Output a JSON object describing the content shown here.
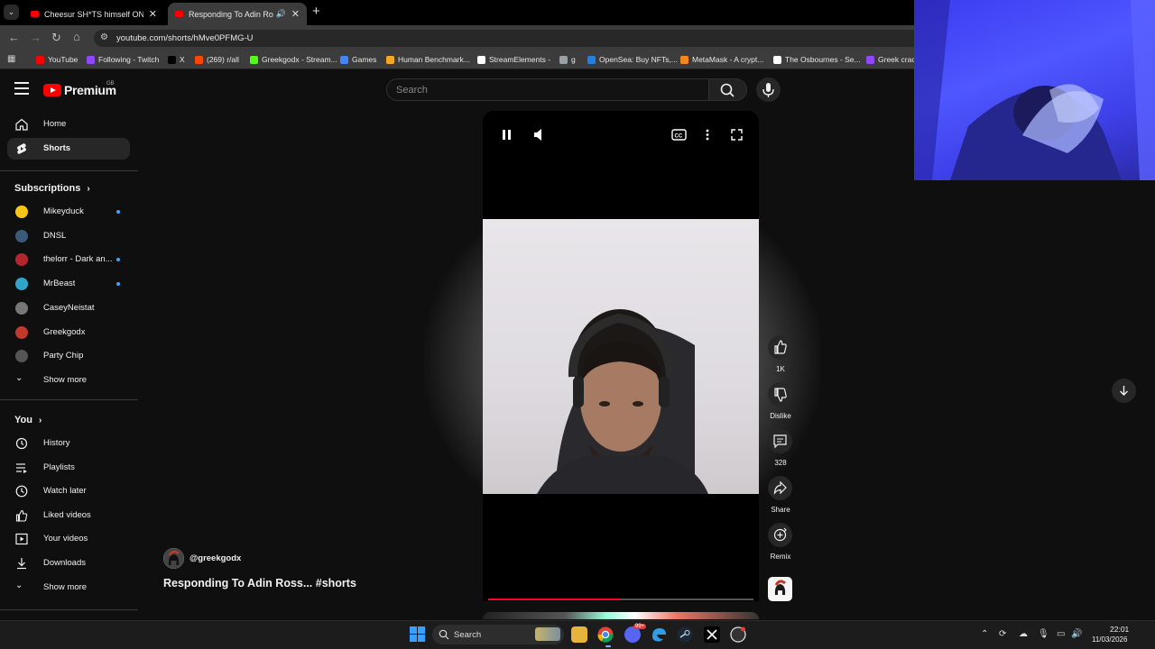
{
  "browser": {
    "tabs": [
      {
        "title": "Cheesur SH*TS himself ON STR",
        "active": false
      },
      {
        "title": "Responding To Adin Ross...",
        "active": true
      }
    ],
    "url": "youtube.com/shorts/hMve0PFMG-U",
    "bookmarks": [
      {
        "label": "YouTube",
        "color": "#ff0000"
      },
      {
        "label": "Following - Twitch",
        "color": "#9146ff"
      },
      {
        "label": "X",
        "color": "#000000"
      },
      {
        "label": "(269) r/all",
        "color": "#ff4500"
      },
      {
        "label": "Greekgodx - Stream...",
        "color": "#53fc18"
      },
      {
        "label": "Games",
        "color": "#4285f4"
      },
      {
        "label": "Human Benchmark...",
        "color": "#f5a623"
      },
      {
        "label": "StreamElements -",
        "color": "#ffffff"
      },
      {
        "label": "g",
        "color": "#9aa0a6"
      },
      {
        "label": "OpenSea: Buy NFTs,...",
        "color": "#2081e2"
      },
      {
        "label": "MetaMask - A crypt...",
        "color": "#f6851b"
      },
      {
        "label": "The Osbournes - Se...",
        "color": "#ffffff"
      },
      {
        "label": "Greek crack",
        "color": "#9146ff"
      }
    ]
  },
  "header": {
    "logo_text": "Premium",
    "country_code": "GB",
    "search_placeholder": "Search"
  },
  "sidebar": {
    "main": [
      {
        "label": "Home",
        "icon": "home-icon",
        "active": false
      },
      {
        "label": "Shorts",
        "icon": "shorts-icon",
        "active": true
      }
    ],
    "subscriptions_title": "Subscriptions",
    "subscriptions": [
      {
        "label": "Mikeyduck",
        "color": "#f5c518",
        "new": true
      },
      {
        "label": "DNSL",
        "color": "#3b5a7a",
        "new": false
      },
      {
        "label": "thelorr - Dark an...",
        "color": "#b3262e",
        "new": true
      },
      {
        "label": "MrBeast",
        "color": "#2fa6c9",
        "new": true
      },
      {
        "label": "CaseyNeistat",
        "color": "#777777",
        "new": false
      },
      {
        "label": "Greekgodx",
        "color": "#c0392b",
        "new": false
      },
      {
        "label": "Party Chip",
        "color": "#555555",
        "new": false
      }
    ],
    "show_more_1": "Show more",
    "you_title": "You",
    "you": [
      {
        "label": "History",
        "icon": "history-icon"
      },
      {
        "label": "Playlists",
        "icon": "playlists-icon"
      },
      {
        "label": "Watch later",
        "icon": "watch-later-icon"
      },
      {
        "label": "Liked videos",
        "icon": "like-icon"
      },
      {
        "label": "Your videos",
        "icon": "your-videos-icon"
      },
      {
        "label": "Downloads",
        "icon": "download-icon"
      }
    ],
    "show_more_2": "Show more"
  },
  "short": {
    "channel": "@greekgodx",
    "title": "Responding To Adin Ross... #shorts",
    "progress": 0.5,
    "likes": "1K",
    "dislike_label": "Dislike",
    "comments": "328",
    "share_label": "Share",
    "remix_label": "Remix"
  },
  "taskbar": {
    "search_label": "Search",
    "time": "22:01",
    "date": "11/03/2026",
    "chat_badge": "99+"
  }
}
